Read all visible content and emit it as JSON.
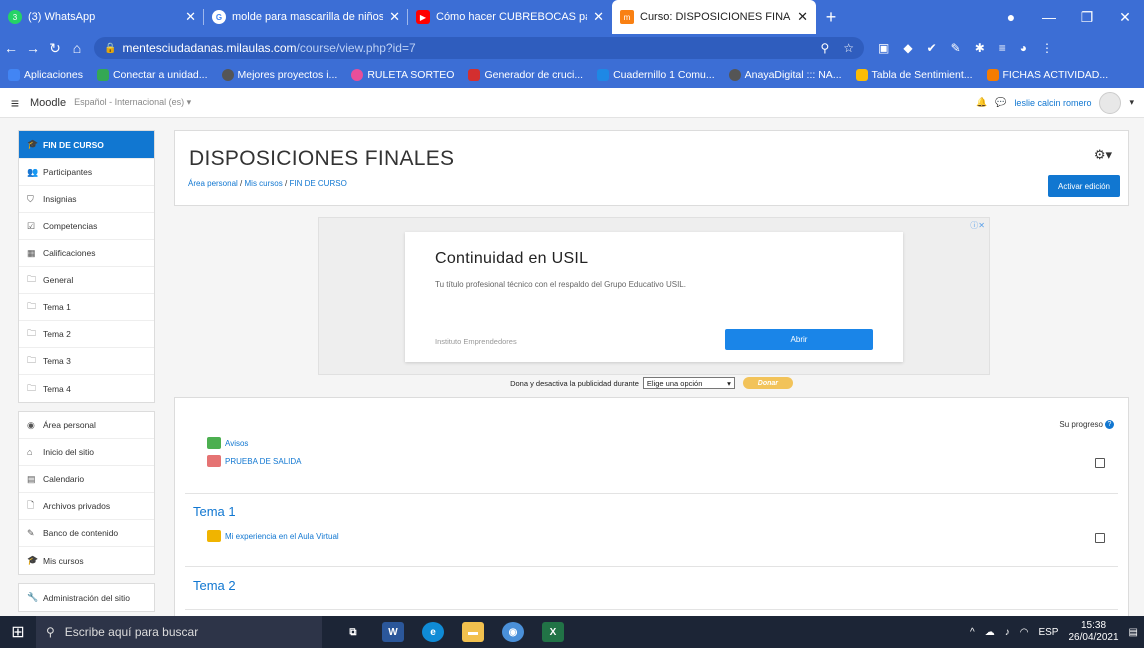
{
  "browser": {
    "tabs": [
      {
        "label": "(3) WhatsApp",
        "icon": "whatsapp-icon",
        "color": "#25d366"
      },
      {
        "label": "molde para mascarilla de niños - ",
        "icon": "google-icon",
        "color": "#ffffff"
      },
      {
        "label": "Cómo hacer CUBREBOCAS para n",
        "icon": "youtube-icon",
        "color": "#ff0000"
      },
      {
        "label": "Curso: DISPOSICIONES FINALES",
        "icon": "milaulas-icon",
        "color": "#f98012"
      }
    ],
    "new_tab": "+",
    "url_host": "mentesciudadanas.milaulas.com",
    "url_path": "/course/view.php?id=7",
    "bookmarks": [
      {
        "label": "Aplicaciones",
        "icon": "apps-grid-icon",
        "color": "#4285f4"
      },
      {
        "label": "Conectar a unidad...",
        "icon": "drive-icon",
        "color": "#34a853"
      },
      {
        "label": "Mejores proyectos i...",
        "icon": "globe-icon",
        "color": "#555555"
      },
      {
        "label": "RULETA SORTEO",
        "icon": "wheel-icon",
        "color": "#e84f9a"
      },
      {
        "label": "Generador de cruci...",
        "icon": "pencil-icon",
        "color": "#d32f2f"
      },
      {
        "label": "Cuadernillo 1 Comu...",
        "icon": "notebook-icon",
        "color": "#1e88e5"
      },
      {
        "label": "AnayaDigital ::: NA...",
        "icon": "globe-icon",
        "color": "#555555"
      },
      {
        "label": "Tabla de Sentimient...",
        "icon": "table-icon",
        "color": "#fbbc05"
      },
      {
        "label": "FICHAS ACTIVIDAD...",
        "icon": "pencil-icon",
        "color": "#f57c00"
      }
    ]
  },
  "moodle": {
    "brand": "Moodle",
    "language": "Español - Internacional (es) ▾",
    "user": "leslie calcin romero"
  },
  "sidebar": {
    "group1": [
      {
        "label": "FIN DE CURSO",
        "icon": "graduation-cap-icon",
        "glyph": "🎓"
      },
      {
        "label": "Participantes",
        "icon": "users-icon",
        "glyph": "👥"
      },
      {
        "label": "Insignias",
        "icon": "shield-icon",
        "glyph": "⛉"
      },
      {
        "label": "Competencias",
        "icon": "checkbox-icon",
        "glyph": "☑"
      },
      {
        "label": "Calificaciones",
        "icon": "table-icon",
        "glyph": "▦"
      },
      {
        "label": "General",
        "icon": "folder-icon",
        "glyph": "🗀"
      },
      {
        "label": "Tema 1",
        "icon": "folder-icon",
        "glyph": "🗀"
      },
      {
        "label": "Tema 2",
        "icon": "folder-icon",
        "glyph": "🗀"
      },
      {
        "label": "Tema 3",
        "icon": "folder-icon",
        "glyph": "🗀"
      },
      {
        "label": "Tema 4",
        "icon": "folder-icon",
        "glyph": "🗀"
      }
    ],
    "group2": [
      {
        "label": "Área personal",
        "icon": "dashboard-icon",
        "glyph": "◉"
      },
      {
        "label": "Inicio del sitio",
        "icon": "home-icon",
        "glyph": "⌂"
      },
      {
        "label": "Calendario",
        "icon": "calendar-icon",
        "glyph": "▤"
      },
      {
        "label": "Archivos privados",
        "icon": "file-icon",
        "glyph": "🗋"
      },
      {
        "label": "Banco de contenido",
        "icon": "pencil-icon",
        "glyph": "✎"
      },
      {
        "label": "Mis cursos",
        "icon": "graduation-cap-icon",
        "glyph": "🎓"
      }
    ],
    "group3": [
      {
        "label": "Administración del sitio",
        "icon": "wrench-icon",
        "glyph": "🔧"
      }
    ]
  },
  "header": {
    "title": "DISPOSICIONES FINALES",
    "breadcrumb_1": "Área personal",
    "breadcrumb_2": "Mis cursos",
    "breadcrumb_3": "FIN DE CURSO",
    "sep": "/",
    "edit_button": "Activar edición"
  },
  "ad": {
    "title": "Continuidad en USIL",
    "subtitle": "Tu título profesional técnico con el respaldo del Grupo Educativo USIL.",
    "source": "Instituto Emprendedores",
    "cta": "Abrir",
    "adchoice": "ⓘ✕"
  },
  "donation": {
    "text": "Dona y desactiva la publicidad durante",
    "select": "Elige una opción",
    "button": "Donar"
  },
  "course": {
    "progress_label": "Su progreso",
    "general_activities": [
      {
        "label": "Avisos",
        "icon": "forum-icon",
        "color": "#4caf50"
      },
      {
        "label": "PRUEBA DE SALIDA",
        "icon": "quiz-icon",
        "color": "#e57373"
      }
    ],
    "sections": [
      {
        "title": "Tema 1",
        "activities": [
          {
            "label": "Mi experiencia en el Aula Virtual",
            "icon": "feedback-icon",
            "color": "#f0b400"
          }
        ]
      },
      {
        "title": "Tema 2"
      }
    ]
  },
  "taskbar": {
    "search_placeholder": "Escribe aquí para buscar",
    "lang": "ESP",
    "time": "15:38",
    "date": "26/04/2021"
  }
}
